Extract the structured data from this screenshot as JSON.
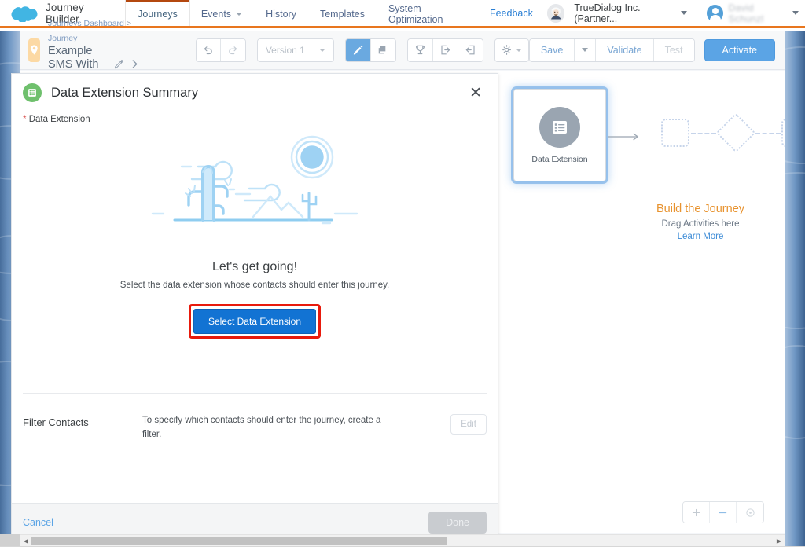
{
  "topnav": {
    "brand": "Journey Builder",
    "brand_logo_icon": "salesforce-cloud-icon",
    "tabs": [
      {
        "label": "Journeys",
        "active": true,
        "has_caret": false
      },
      {
        "label": "Events",
        "active": false,
        "has_caret": true
      },
      {
        "label": "History",
        "active": false,
        "has_caret": false
      },
      {
        "label": "Templates",
        "active": false,
        "has_caret": false
      },
      {
        "label": "System Optimization",
        "active": false,
        "has_caret": false
      }
    ],
    "feedback": "Feedback",
    "einstein_icon": "einstein-avatar-icon",
    "org": "TrueDialog Inc. (Partner...",
    "user": "David Schunzl",
    "accent_color": "#e8761e",
    "active_tab_border_color": "#b4480f"
  },
  "toolbar": {
    "breadcrumb_parent": "Journeys Dashboard",
    "breadcrumb_sep": ">",
    "breadcrumb_child": "Journey",
    "journey_title": "Example SMS With Testing DE",
    "pin_icon": "location-pin-icon",
    "edit_icon": "pencil-icon",
    "expand_icon": "chevron-right-icon",
    "undo_icon": "undo-icon",
    "redo_icon": "redo-icon",
    "version_label": "Version 1",
    "edit_mode_icon": "pencil-icon",
    "layers_icon": "layers-icon",
    "goals_icon": "trophy-icon",
    "entry_icon": "entry-source-icon",
    "exit_icon": "exit-criteria-icon",
    "settings_icon": "gear-icon",
    "save_label": "Save",
    "save_caret_icon": "chevron-down-icon",
    "validate_label": "Validate",
    "test_label": "Test",
    "activate_label": "Activate",
    "activate_color": "#5ba4e5"
  },
  "modal": {
    "icon": "data-extension-icon",
    "icon_color": "#6fc06d",
    "title": "Data Extension Summary",
    "close_icon": "close-icon",
    "required_marker": "*",
    "required_label": "Data Extension",
    "illustration": "desert-cactus-illustration",
    "empty_title": "Let's get going!",
    "empty_subtitle": "Select the data extension whose contacts should enter this journey.",
    "select_button": "Select Data Extension",
    "select_button_color": "#1273d3",
    "highlight_color": "#e81a0c",
    "filter_label": "Filter Contacts",
    "filter_description": "To specify which contacts should enter the journey, create a filter.",
    "edit_button": "Edit",
    "cancel_label": "Cancel",
    "done_label": "Done"
  },
  "canvas": {
    "node_label": "Data Extension",
    "node_icon": "data-extension-list-icon",
    "build_title": "Build the Journey",
    "build_subtitle": "Drag Activities here",
    "build_link": "Learn More",
    "build_title_color": "#e8932f",
    "zoom_in_icon": "plus-icon",
    "zoom_out_icon": "minus-icon",
    "zoom_reset_icon": "target-reset-icon"
  },
  "scrollbar": {
    "left_arrow_icon": "triangle-left-icon",
    "right_arrow_icon": "triangle-right-icon"
  }
}
